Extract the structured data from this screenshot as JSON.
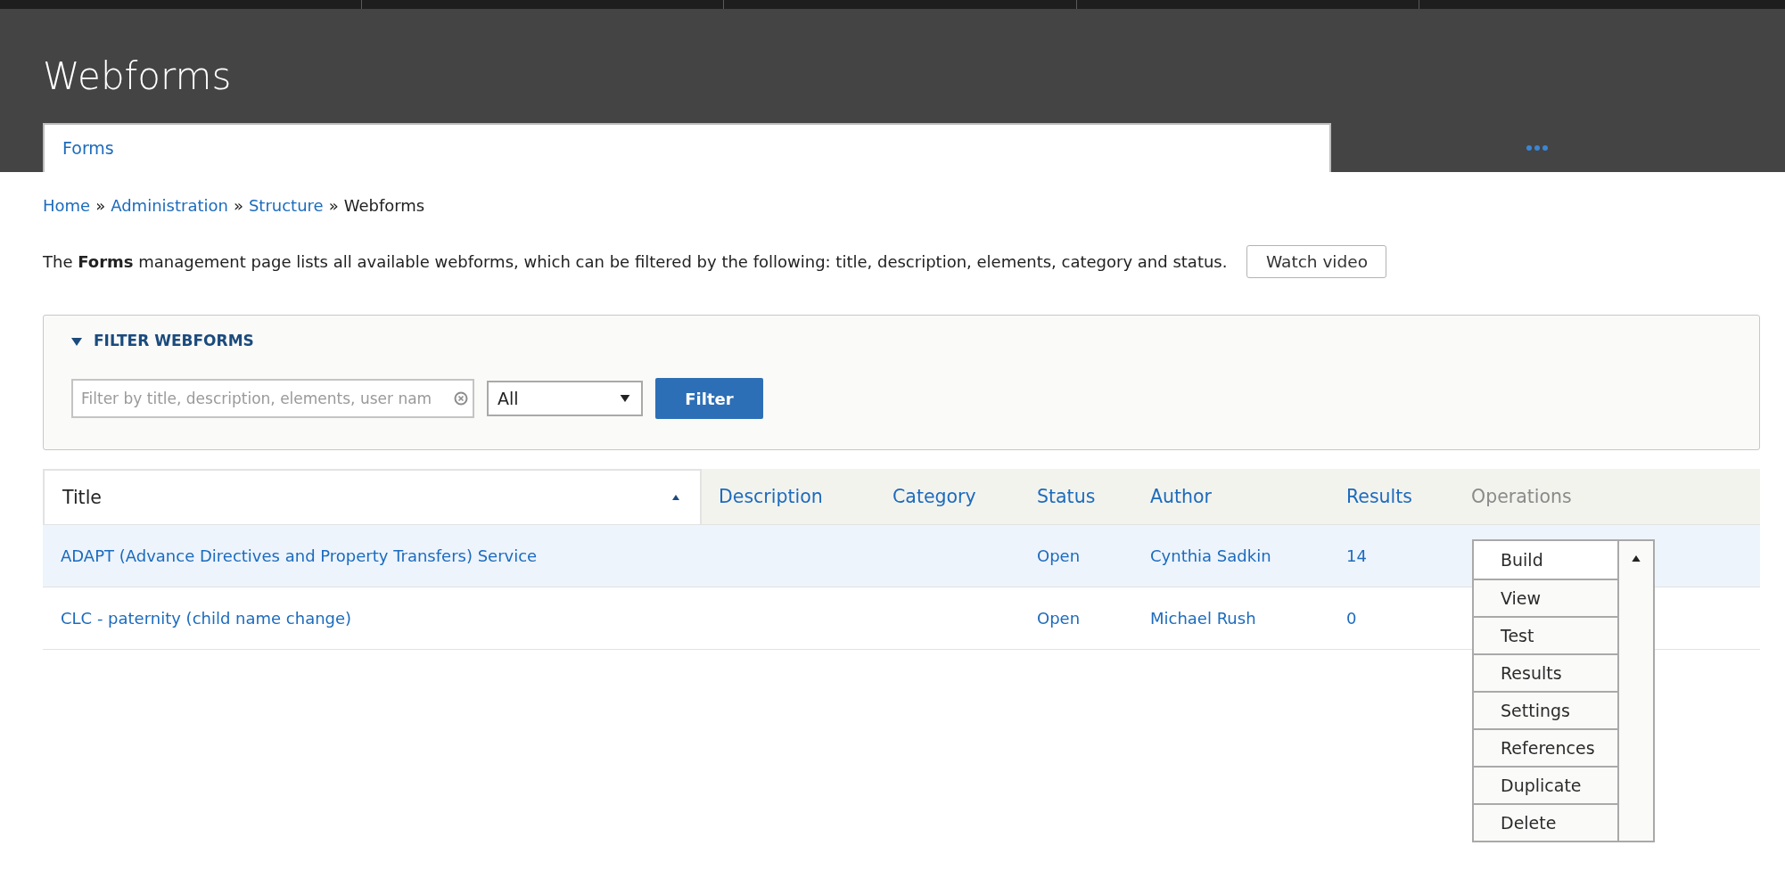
{
  "header": {
    "title": "Webforms",
    "tabs": [
      {
        "label": "Forms",
        "selected": true
      }
    ]
  },
  "breadcrumb": [
    {
      "label": "Home",
      "link": true,
      "separator": "»"
    },
    {
      "label": "Administration",
      "link": true,
      "separator": "»"
    },
    {
      "label": "Structure",
      "link": true,
      "separator": "»"
    },
    {
      "label": "Webforms",
      "link": false
    }
  ],
  "intro": {
    "text": "The **Forms** management page lists all available webforms, which can be filtered by the following: title, description, elements, category and status.",
    "button": "Watch video"
  },
  "filter": {
    "legend": "FILTER WEBFORMS",
    "expanded": true,
    "search": {
      "placeholder": "Filter by title, description, elements, user nam"
    },
    "status_select": {
      "value": "All"
    },
    "button": "Filter"
  },
  "table": {
    "columns": [
      {
        "label": "Title",
        "kind": "link",
        "sorted": true
      },
      {
        "label": "Description",
        "kind": "link",
        "sorted": false
      },
      {
        "label": "Category",
        "kind": "link",
        "sorted": false
      },
      {
        "label": "Status",
        "kind": "link",
        "sorted": false
      },
      {
        "label": "Author",
        "kind": "link",
        "sorted": false
      },
      {
        "label": "Results",
        "kind": "link",
        "sorted": false
      },
      {
        "label": "Operations",
        "kind": "text",
        "sorted": false
      }
    ],
    "rows": [
      {
        "title": "ADAPT (Advance Directives and Property Transfers) Service",
        "status": "Open",
        "author": "Cynthia Sadkin",
        "results": "14",
        "highlighted": true,
        "operations": {
          "expanded": true,
          "items": [
            "Build",
            "View",
            "Test",
            "Results",
            "Settings",
            "References",
            "Duplicate",
            "Delete"
          ]
        }
      },
      {
        "title": "CLC - paternity (child name change)",
        "status": "Open",
        "author": "Michael Rush",
        "results": "0",
        "highlighted": false
      }
    ]
  }
}
